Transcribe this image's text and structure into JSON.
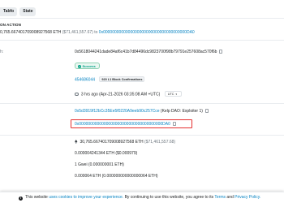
{
  "tabs": [
    "7702 Authorizations",
    "State"
  ],
  "tabs_visible": [
    "Tabfo",
    "State"
  ],
  "action": {
    "title_partial": "ON ACTION",
    "amount_partial": "0,765.667401709008927568 ETH",
    "usd_value": "($71,461,557.67)",
    "to_word": "to",
    "to_address": "0x0000000000000000000000000000000000000DA0"
  },
  "fields": {
    "hash_label_partial": "h:",
    "tx_hash": "0x5618044241dade84af6c41b7d84496dc9823700f98b79791e257608ac570f6b",
    "status": "Success",
    "block": "454686044",
    "confirmations": "920 L1 Block Confirmations",
    "timestamp": "3 hrs ago (Apr-21-2026 03:35:08 AM +UTC)",
    "timezone": "UTC",
    "from_address": "0x5d3919f12bCc35Ee5f0220A9eeb90c257Cce",
    "from_tag": "(Kelp DAO: Exploiter 1)",
    "to_address": "0x0000000000000000000000000000000000000DA0",
    "value_eth": "30,765.667401709008927568 ETH",
    "value_usd": "($71,461,557.68)",
    "fee": "0.000004241344 ETH ($0.000979)",
    "gas_price": "1 Gwei (0.000000001 ETH)",
    "l1_fee": "0.000064 ETH (0.000000000000000064 ETH)"
  },
  "cookie": {
    "prefix": "This website",
    "link1": "uses cookies to improve your experience.",
    "middle": "By continuing to use this website, you agree to its",
    "terms": "Terms",
    "and": "and",
    "privacy": "Privacy Policy."
  },
  "colors": {
    "link": "#0784c3",
    "success": "#00a186",
    "highlight": "#e52f2f"
  }
}
